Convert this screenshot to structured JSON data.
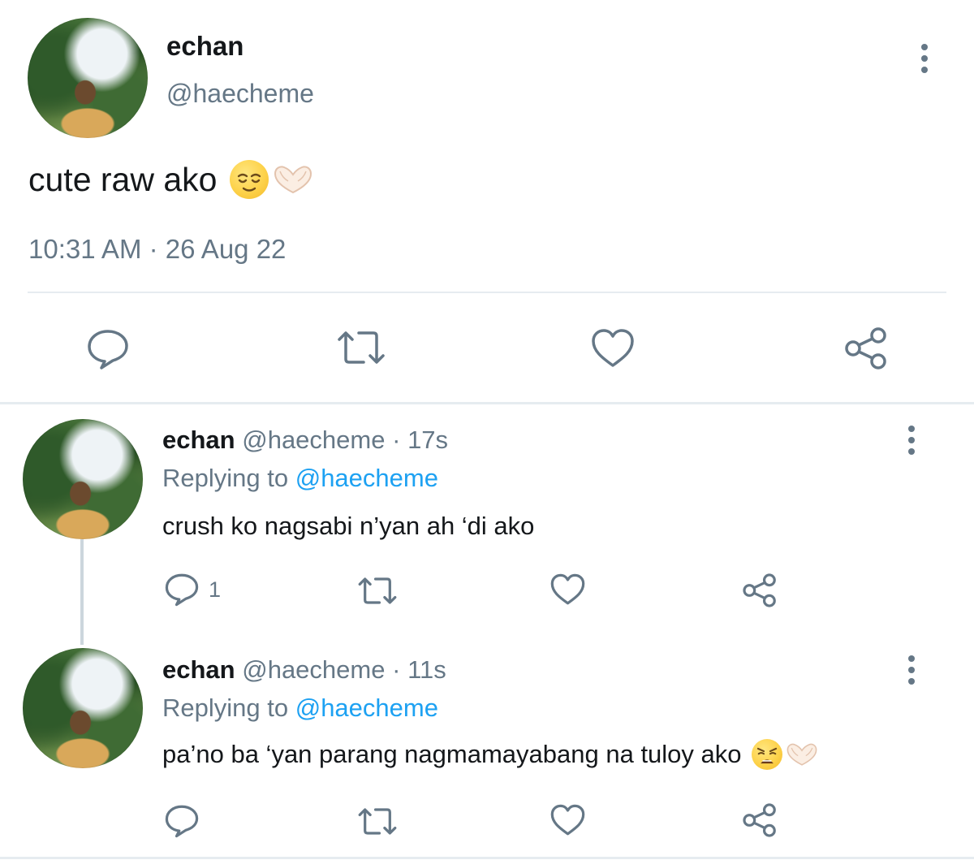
{
  "main_tweet": {
    "name": "echan",
    "handle": "@haecheme",
    "text": "cute raw ako",
    "emojis": [
      "relieved-face",
      "heart-hands"
    ],
    "timestamp": "10:31 AM · 26 Aug 22",
    "actions": [
      "reply",
      "retweet",
      "like",
      "share"
    ]
  },
  "replies": [
    {
      "name": "echan",
      "handle": "@haecheme",
      "dot": "·",
      "time": "17s",
      "replying_label": "Replying to",
      "replying_to": "@haecheme",
      "text": "crush ko nagsabi n’yan ah ‘di ako",
      "reply_count": "1"
    },
    {
      "name": "echan",
      "handle": "@haecheme",
      "dot": "·",
      "time": "11s",
      "replying_label": "Replying to",
      "replying_to": "@haecheme",
      "text": "pa’no ba ‘yan parang nagmamayabang na tuloy ako",
      "emojis": [
        "weary-face",
        "heart-hands"
      ]
    }
  ],
  "colors": {
    "text": "#14171a",
    "secondary": "#657786",
    "link": "#1da1f2",
    "divider": "#e6ecf0"
  }
}
